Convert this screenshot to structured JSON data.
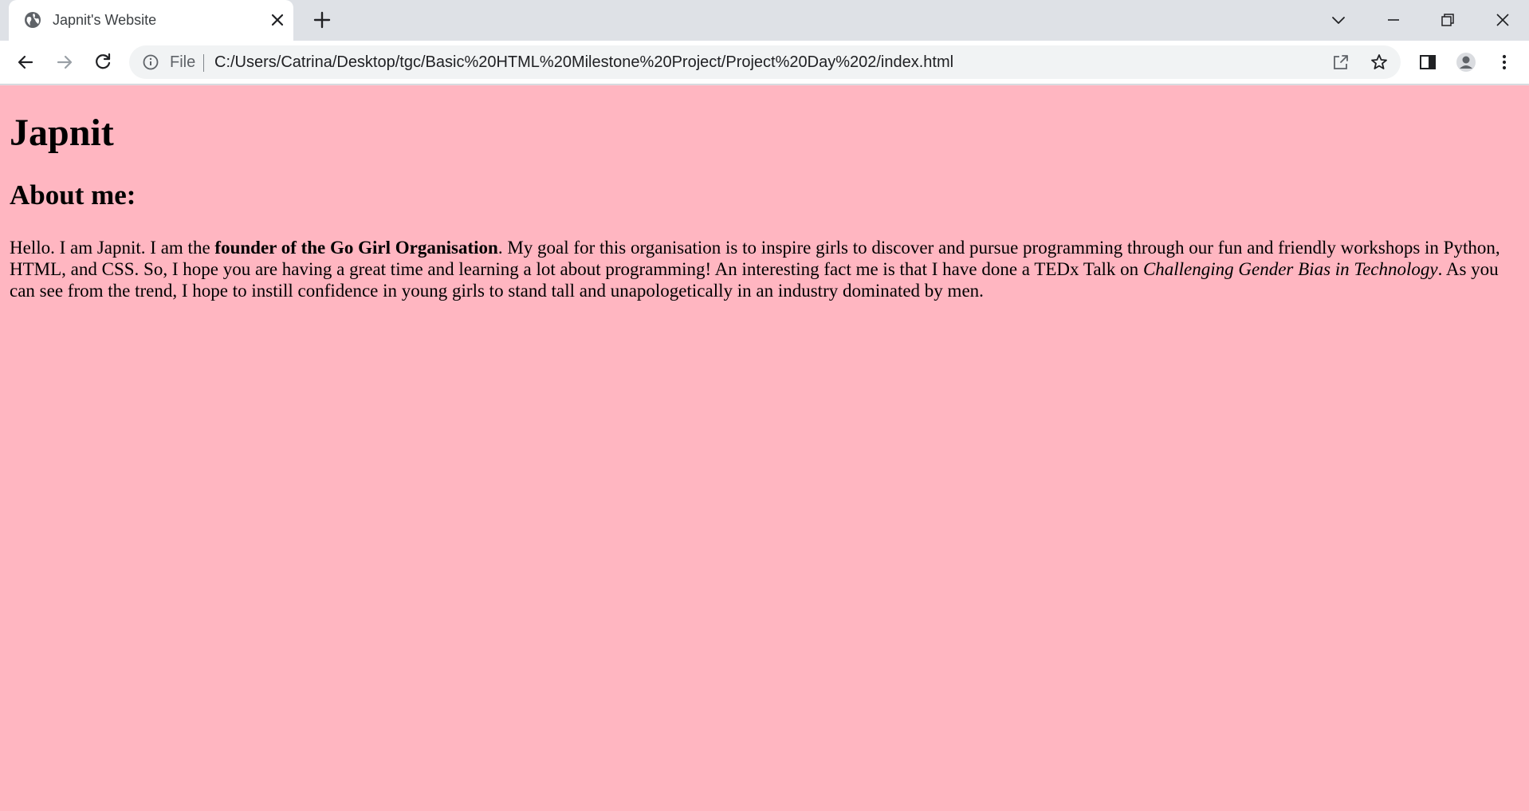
{
  "browser": {
    "tab": {
      "title": "Japnit's Website",
      "favicon": "globe-icon"
    },
    "omnibox": {
      "scheme_label": "File",
      "url": "C:/Users/Catrina/Desktop/tgc/Basic%20HTML%20Milestone%20Project/Project%20Day%202/index.html"
    },
    "colors": {
      "tabstrip": "#dee1e6",
      "toolbar": "#ffffff",
      "omnibox": "#f1f3f4"
    }
  },
  "page": {
    "background": "#ffb6c1",
    "heading": "Japnit",
    "subheading": "About me:",
    "about": {
      "intro": "Hello. I am Japnit. I am the ",
      "bold": "founder of the Go Girl Organisation",
      "middle": ". My goal for this organisation is to inspire girls to discover and pursue programming through our fun and friendly workshops in Python, HTML, and CSS. So, I hope you are having a great time and learning a lot about programming! An interesting fact me is that I have done a TEDx Talk on ",
      "italic": "Challenging Gender Bias in Technology",
      "end": ". As you can see from the trend, I hope to instill confidence in young girls to stand tall and unapologetically in an industry dominated by men."
    }
  }
}
